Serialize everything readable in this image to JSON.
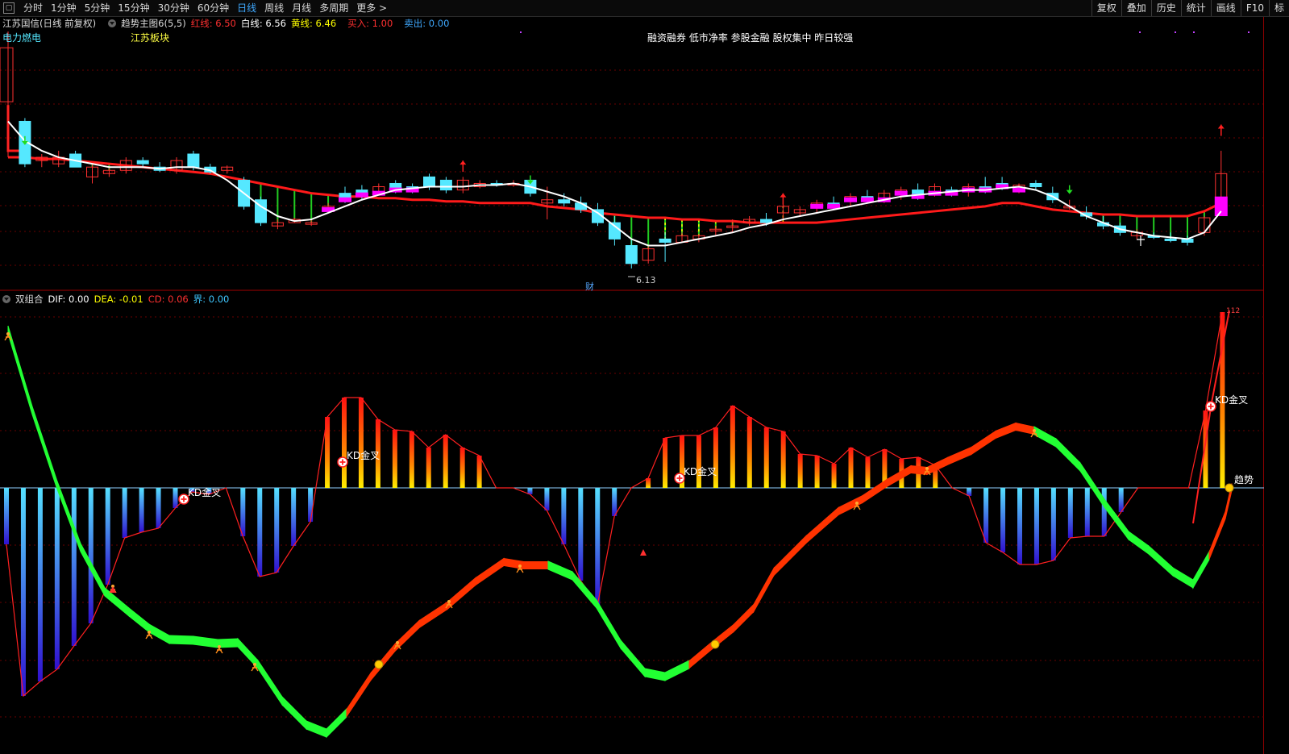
{
  "toolbar": {
    "periods": [
      "分时",
      "1分钟",
      "5分钟",
      "15分钟",
      "30分钟",
      "60分钟",
      "日线",
      "周线",
      "月线",
      "多周期",
      "更多 >"
    ],
    "active_period": "日线",
    "right_buttons": [
      "复权",
      "叠加",
      "历史",
      "统计",
      "画线",
      "F10",
      "标"
    ]
  },
  "main_panel": {
    "stock": "江苏国信",
    "mode": "(日线 前复权)",
    "indicator": "趋势主图6(5,5)",
    "red_line": "红线: 6.50",
    "white_line": "白线: 6.56",
    "yellow_line": "黄线: 6.46",
    "buy": "买入: 1.00",
    "sell": "卖出: 0.00",
    "tag_left": "电力燃电",
    "tag_sector": "江苏板块",
    "concepts": "融资融券 低市净率 参股金融 股权集中 昨日较强",
    "low_price_label": "6.13",
    "finance_mark": "财",
    "colors": {
      "up": "#ff3030",
      "down": "#55e8ff",
      "trend_red": "#ff1a1a",
      "ma_white": "#ffffff",
      "bar_green": "#22cc22",
      "bar_magenta": "#ff00ff"
    }
  },
  "sub_panel": {
    "name": "双组合",
    "dif": "DIF: 0.00",
    "dea": "DEA: -0.01",
    "cd": "CD: 0.06",
    "jie": "界: 0.00",
    "kd_label": "KD金叉",
    "trend_label": "趋势",
    "top_label": "112"
  },
  "chart_data": [
    {
      "type": "candlestick",
      "title": "江苏国信 (日线 前复权)",
      "min_price_marked": 6.13,
      "closes_trend": "declining from left peak then range-bound, rebound at far right",
      "ma_values": {
        "red": 6.5,
        "white": 6.56,
        "yellow": 6.46
      }
    },
    {
      "type": "bar",
      "title": "双组合",
      "values": {
        "DIF": 0.0,
        "DEA": -0.01,
        "CD": 0.06,
        "界": 0.0
      },
      "annotations": [
        "KD金叉",
        "KD金叉",
        "KD金叉",
        "KD金叉",
        "趋势"
      ]
    }
  ]
}
